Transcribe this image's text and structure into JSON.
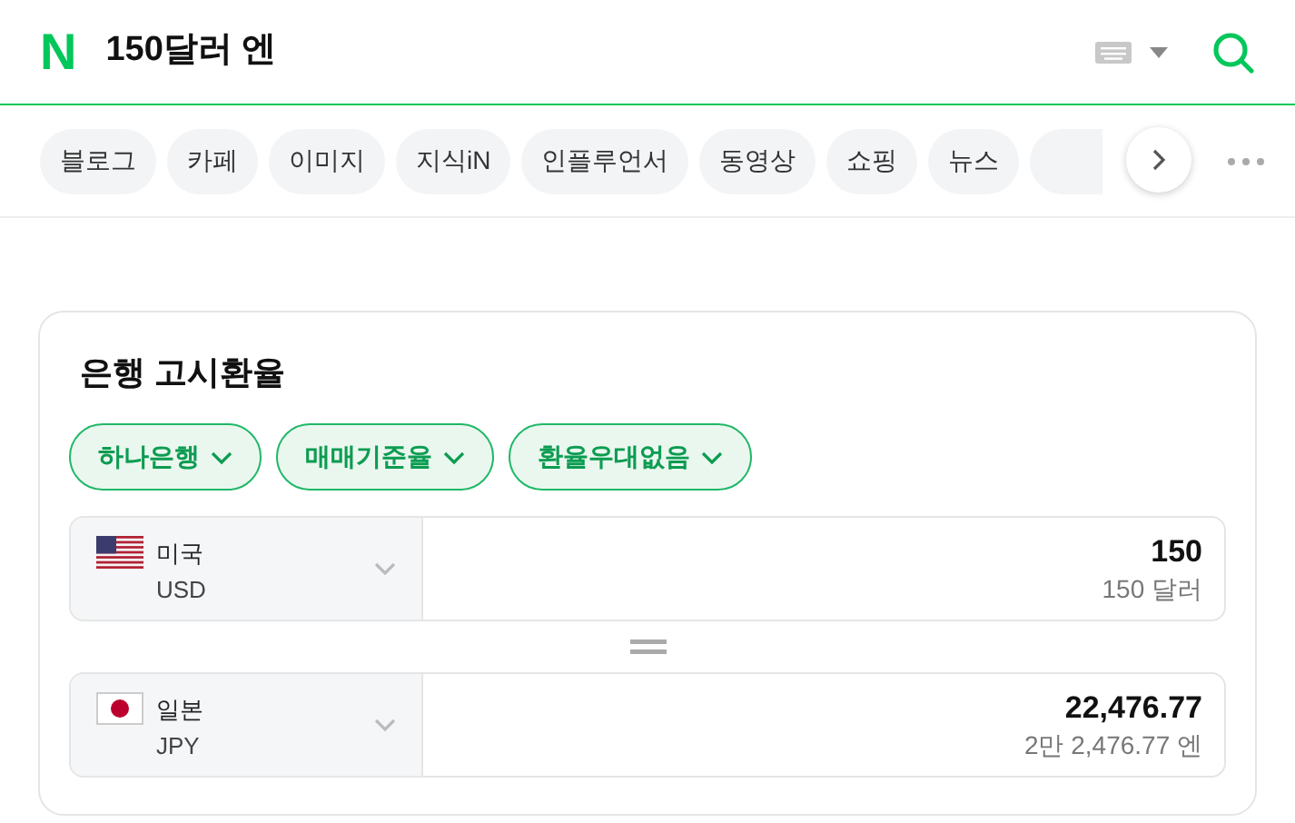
{
  "header": {
    "logo": "N",
    "query": "150달러 엔"
  },
  "tabs": [
    {
      "label": "블로그"
    },
    {
      "label": "카페"
    },
    {
      "label": "이미지"
    },
    {
      "label": "지식iN"
    },
    {
      "label": "인플루언서"
    },
    {
      "label": "동영상"
    },
    {
      "label": "쇼핑"
    },
    {
      "label": "뉴스"
    }
  ],
  "exchange": {
    "title": "은행 고시환율",
    "filters": [
      {
        "label": "하나은행"
      },
      {
        "label": "매매기준율"
      },
      {
        "label": "환율우대없음"
      }
    ],
    "rows": [
      {
        "kind": "us",
        "country": "미국",
        "code": "USD",
        "amount": "150",
        "reading": "150 달러"
      },
      {
        "kind": "jp",
        "country": "일본",
        "code": "JPY",
        "amount": "22,476.77",
        "reading": "2만 2,476.77 엔"
      }
    ]
  }
}
